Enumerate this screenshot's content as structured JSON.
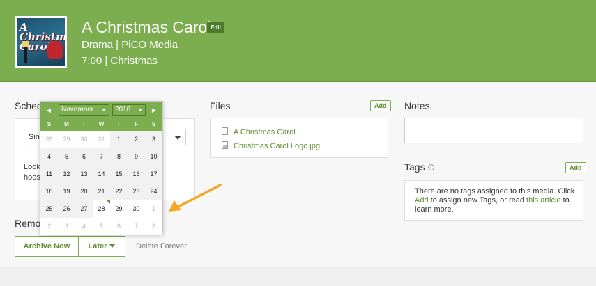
{
  "header": {
    "title": "A Christmas Carol",
    "edit_label": "Edit",
    "meta_line1": "Drama | PiCO Media",
    "meta_line2": "7:00 | Christmas",
    "poster_text_line1": "A",
    "poster_text_line2": "Christmas",
    "poster_text_line3": "Carol"
  },
  "schedule": {
    "heading": "Sched",
    "select_value": "Sin",
    "text": "Look                                  g this time.                                 hoose a diff"
  },
  "calendar": {
    "month": "November",
    "year": "2018",
    "prev_icon": "◀",
    "next_icon": "▶",
    "weekdays": [
      "S",
      "M",
      "T",
      "W",
      "T",
      "F",
      "S"
    ],
    "weeks": [
      [
        "28",
        "29",
        "30",
        "31",
        "1",
        "2",
        "3"
      ],
      [
        "4",
        "5",
        "6",
        "7",
        "8",
        "9",
        "10"
      ],
      [
        "11",
        "12",
        "13",
        "14",
        "15",
        "16",
        "17"
      ],
      [
        "18",
        "19",
        "20",
        "21",
        "22",
        "23",
        "24"
      ],
      [
        "25",
        "26",
        "27",
        "28",
        "29",
        "30",
        "1"
      ],
      [
        "2",
        "3",
        "4",
        "5",
        "6",
        "7",
        "8"
      ]
    ],
    "today_marker_color": "#5e8f30"
  },
  "files": {
    "heading": "Files",
    "add_label": "Add",
    "items": [
      {
        "name": "A Christmas Carol",
        "icon": "pdf-file-icon"
      },
      {
        "name": "Christmas Carol Logo.jpg",
        "icon": "image-file-icon"
      }
    ]
  },
  "notes": {
    "heading": "Notes"
  },
  "tags": {
    "heading": "Tags",
    "add_label": "Add",
    "empty_text_1": "There are no tags assigned to this media. Click ",
    "add_link": "Add",
    "empty_text_2": " to assign new Tags, or read ",
    "article_link": "this article",
    "empty_text_3": " to learn more."
  },
  "remove": {
    "heading": "Remov",
    "archive_label": "Archive Now",
    "later_label": "Later",
    "delete_label": "Delete Forever"
  },
  "colors": {
    "brand_green": "#7cad4e",
    "link_green": "#5e8f30",
    "annotation_arrow": "#f5a623"
  }
}
